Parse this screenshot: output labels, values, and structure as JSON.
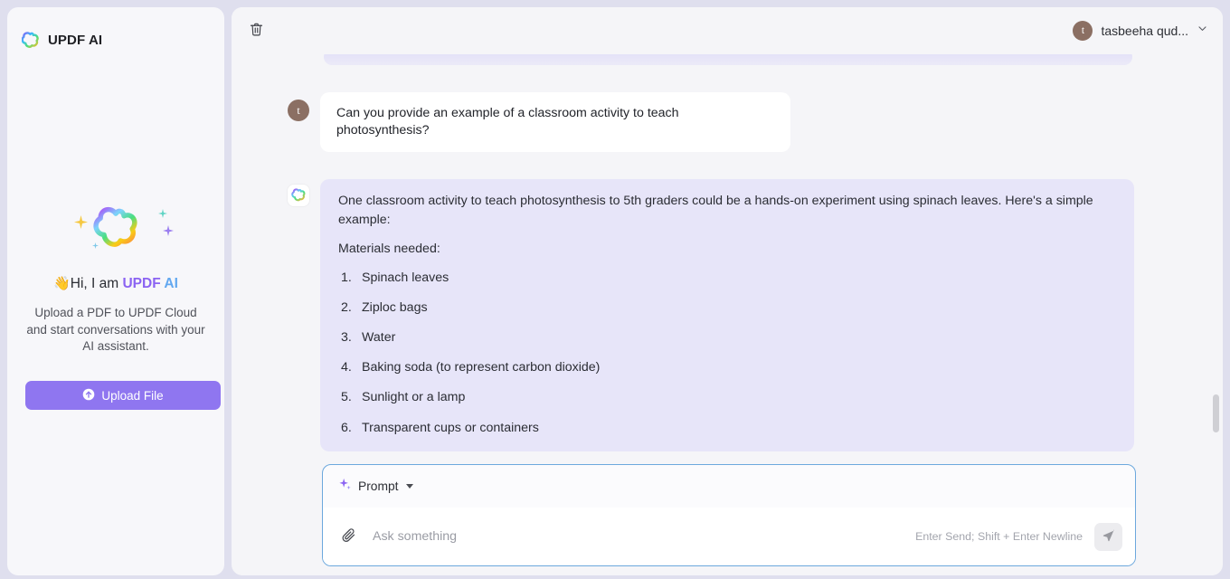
{
  "brand": {
    "name": "UPDF AI",
    "logo_icon": "updf-clover-logo"
  },
  "sidebar": {
    "hero": {
      "logo_icon": "updf-clover-logo-large",
      "wave_emoji": "👋",
      "greeting_prefix": "Hi, I am ",
      "greeting_brand": "UPDF",
      "greeting_brand_suffix": " AI",
      "description": "Upload a PDF to UPDF Cloud and start conversations with your AI assistant."
    },
    "upload_button": {
      "label": "Upload File",
      "icon": "upload-circle-arrow-icon"
    }
  },
  "topbar": {
    "delete_icon": "trash-icon",
    "user": {
      "avatar_initial": "t",
      "name": "tasbeeha qud...",
      "chevron_icon": "chevron-down-icon"
    }
  },
  "chat": {
    "messages": [
      {
        "role": "user",
        "avatar_initial": "t",
        "text": "Can you provide an example of a classroom activity to teach photosynthesis?"
      },
      {
        "role": "assistant",
        "avatar_icon": "updf-clover-logo-small",
        "paragraphs": [
          "One classroom activity to teach photosynthesis to 5th graders could be a hands-on experiment using spinach leaves. Here's a simple example:",
          "Materials needed:"
        ],
        "list": [
          "Spinach leaves",
          "Ziploc bags",
          "Water",
          "Baking soda (to represent carbon dioxide)",
          "Sunlight or a lamp",
          "Transparent cups or containers"
        ]
      }
    ]
  },
  "composer": {
    "prompt_button": {
      "label": "Prompt",
      "icon": "sparkle-icon",
      "caret_icon": "caret-down-icon"
    },
    "attach_icon": "paperclip-icon",
    "input_value": "",
    "input_placeholder": "Ask something",
    "hint": "Enter Send; Shift + Enter Newline",
    "send_icon": "send-paper-plane-icon"
  },
  "colors": {
    "page_background": "#dfdfee",
    "panel_background": "#f5f5f8",
    "sidebar_background": "#f7f7fa",
    "accent_purple": "#8b63f2",
    "accent_blue": "#62a8f0",
    "upload_button": "#8f76f0",
    "assistant_bubble": "#e7e5f9",
    "user_bubble": "#ffffff",
    "composer_border": "#6ca8dd",
    "avatar": "#8b6f63"
  }
}
